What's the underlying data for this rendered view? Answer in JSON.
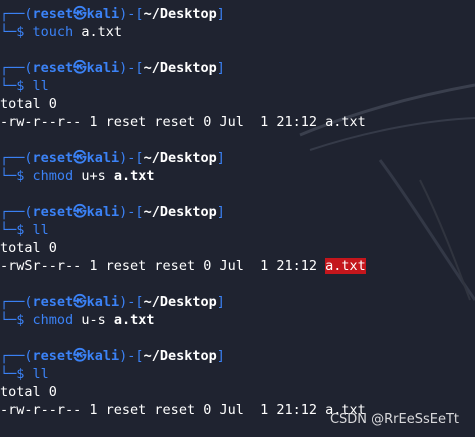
{
  "prompt": {
    "user": "reset",
    "host": "kali",
    "dir": "~/Desktop",
    "dollar": "$"
  },
  "blocks": [
    {
      "cmd": "touch",
      "arg": "a.txt",
      "arg_bold": false,
      "output": []
    },
    {
      "cmd": "ll",
      "arg": "",
      "arg_bold": false,
      "output": [
        {
          "text": "total 0"
        },
        {
          "perm": "-rw-r--r--",
          "rest": " 1 reset reset 0 Jul  1 21:12 ",
          "file": "a.txt",
          "highlight": false
        }
      ]
    },
    {
      "cmd": "chmod",
      "arg": "u+s ",
      "argb": "a.txt",
      "output": []
    },
    {
      "cmd": "ll",
      "arg": "",
      "arg_bold": false,
      "output": [
        {
          "text": "total 0"
        },
        {
          "perm": "-rwSr--r--",
          "rest": " 1 reset reset 0 Jul  1 21:12 ",
          "file": "a.txt",
          "highlight": true
        }
      ]
    },
    {
      "cmd": "chmod",
      "arg": "u-s ",
      "argb": "a.txt",
      "output": []
    },
    {
      "cmd": "ll",
      "arg": "",
      "arg_bold": false,
      "output": [
        {
          "text": "total 0"
        },
        {
          "perm": "-rw-r--r--",
          "rest": " 1 reset reset 0 Jul  1 21:12 ",
          "file": "a.txt",
          "highlight": false
        }
      ]
    }
  ],
  "watermark": "CSDN @RrEeSsEeTt",
  "colors": {
    "background": "#1f2330",
    "prompt_blue": "#3b82f6",
    "highlight_red": "#c4161c"
  }
}
